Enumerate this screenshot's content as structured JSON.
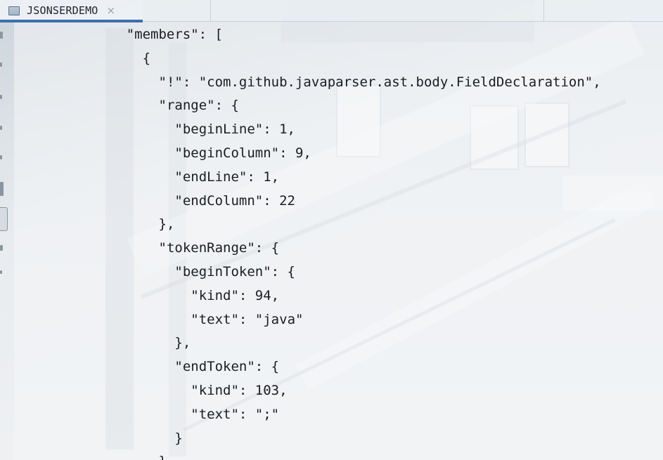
{
  "tab": {
    "title": "JSONSERDEMO",
    "close_glyph": "×",
    "icon": "json-file-icon"
  },
  "editor": {
    "lines": [
      {
        "indent": 6,
        "text": "\"members\": ["
      },
      {
        "indent": 8,
        "text": "{"
      },
      {
        "indent": 10,
        "text": "\"!\": \"com.github.javaparser.ast.body.FieldDeclaration\","
      },
      {
        "indent": 10,
        "text": "\"range\": {"
      },
      {
        "indent": 12,
        "text": "\"beginLine\": 1,"
      },
      {
        "indent": 12,
        "text": "\"beginColumn\": 9,"
      },
      {
        "indent": 12,
        "text": "\"endLine\": 1,"
      },
      {
        "indent": 12,
        "text": "\"endColumn\": 22"
      },
      {
        "indent": 10,
        "text": "},"
      },
      {
        "indent": 10,
        "text": "\"tokenRange\": {"
      },
      {
        "indent": 12,
        "text": "\"beginToken\": {"
      },
      {
        "indent": 14,
        "text": "\"kind\": 94,"
      },
      {
        "indent": 14,
        "text": "\"text\": \"java\""
      },
      {
        "indent": 12,
        "text": "},"
      },
      {
        "indent": 12,
        "text": "\"endToken\": {"
      },
      {
        "indent": 14,
        "text": "\"kind\": 103,"
      },
      {
        "indent": 14,
        "text": "\"text\": \";\""
      },
      {
        "indent": 12,
        "text": "}"
      },
      {
        "indent": 10,
        "text": "}"
      }
    ]
  },
  "colors": {
    "tab_underline": "#3d6fae",
    "text": "#1a1d21"
  }
}
